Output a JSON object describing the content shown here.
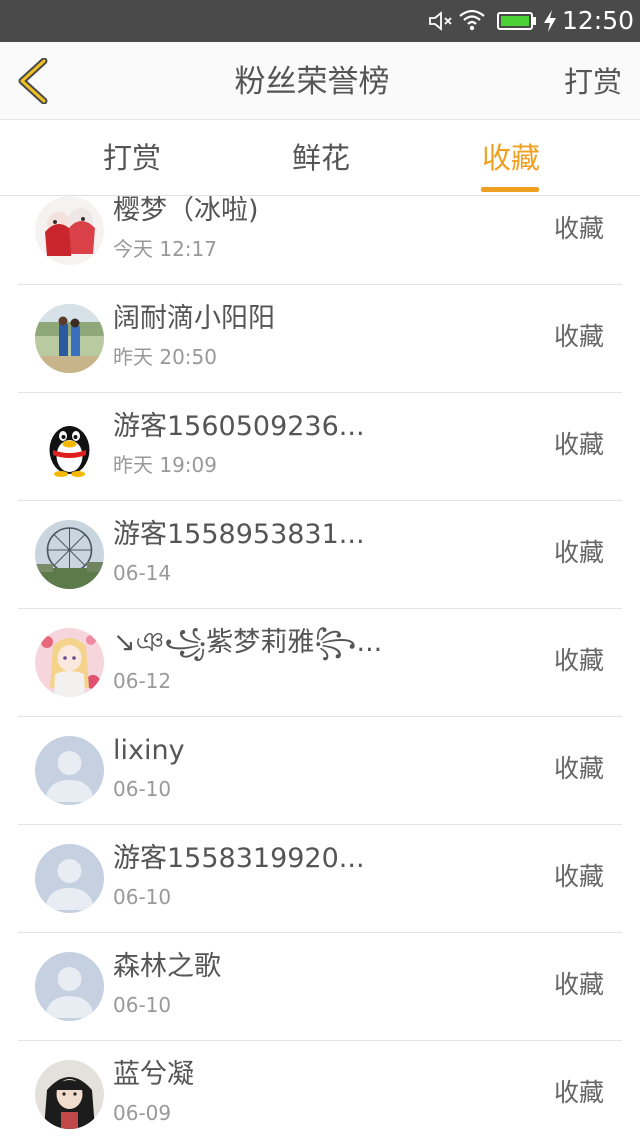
{
  "status_bar": {
    "time": "12:50",
    "icons": [
      "mute-icon",
      "wifi-icon",
      "battery-icon",
      "charging-icon"
    ],
    "battery_color": "#4cd137"
  },
  "header": {
    "title": "粉丝荣誉榜",
    "right_link": "打赏",
    "back_icon": "chevron-left-icon",
    "accent_color": "#f0a020"
  },
  "tabs": [
    {
      "label": "打赏",
      "active": false
    },
    {
      "label": "鲜花",
      "active": false
    },
    {
      "label": "收藏",
      "active": true
    }
  ],
  "fans": [
    {
      "name": "樱梦（冰啦)",
      "time": "今天 12:17",
      "action": "收藏",
      "avatar": "anime-girls-avatar"
    },
    {
      "name": "阔耐滴小阳阳",
      "time": "昨天 20:50",
      "action": "收藏",
      "avatar": "photo-couple-avatar"
    },
    {
      "name": "游客1560509236...",
      "time": "昨天 19:09",
      "action": "收藏",
      "avatar": "qq-penguin-avatar"
    },
    {
      "name": "游客1558953831...",
      "time": "06-14",
      "action": "收藏",
      "avatar": "ferris-wheel-avatar"
    },
    {
      "name": "↘ঞ꧁紫梦莉雅꧂...",
      "time": "06-12",
      "action": "收藏",
      "avatar": "anime-pink-avatar"
    },
    {
      "name": "lixiny",
      "time": "06-10",
      "action": "收藏",
      "avatar": "default-user-avatar"
    },
    {
      "name": "游客1558319920...",
      "time": "06-10",
      "action": "收藏",
      "avatar": "default-user-avatar"
    },
    {
      "name": "森林之歌",
      "time": "06-10",
      "action": "收藏",
      "avatar": "default-user-avatar"
    },
    {
      "name": "蓝兮凝",
      "time": "06-09",
      "action": "收藏",
      "avatar": "photo-girl-avatar"
    }
  ]
}
